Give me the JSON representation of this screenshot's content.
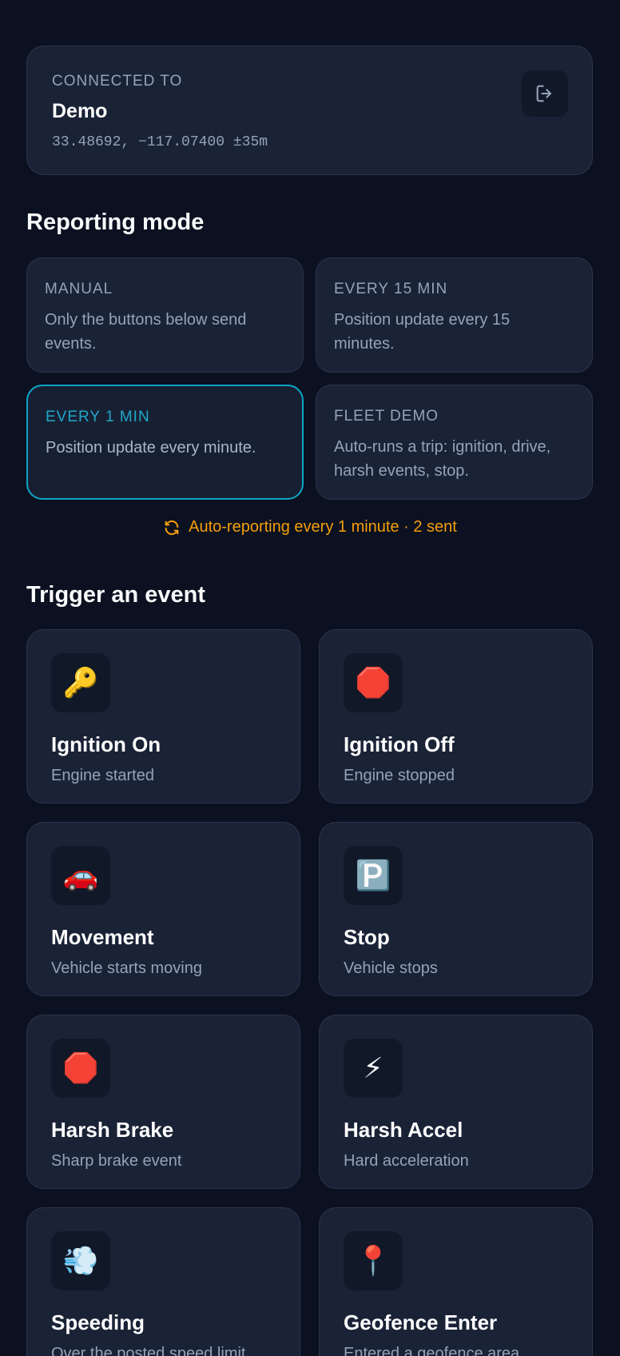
{
  "connection": {
    "label": "CONNECTED TO",
    "name": "Demo",
    "coords": "33.48692, −117.07400 ±35m",
    "logout_icon": "logout-icon"
  },
  "reporting": {
    "title": "Reporting mode",
    "modes": [
      {
        "title": "MANUAL",
        "desc": "Only the buttons below send events.",
        "active": false
      },
      {
        "title": "EVERY 15 MIN",
        "desc": "Position update every 15 minutes.",
        "active": false
      },
      {
        "title": "EVERY 1 MIN",
        "desc": "Position update every minute.",
        "active": true
      },
      {
        "title": "FLEET DEMO",
        "desc": "Auto-runs a trip: ignition, drive, harsh events, stop.",
        "active": false
      }
    ],
    "status": "Auto-reporting every 1 minute · 2 sent",
    "status_color": "#f59e0b",
    "active_color": "#0ea5c6"
  },
  "events": {
    "title": "Trigger an event",
    "items": [
      {
        "icon": "🔑",
        "icon_name": "key-icon",
        "title": "Ignition On",
        "sub": "Engine started"
      },
      {
        "icon": "🛑",
        "icon_name": "stop-sign-icon",
        "title": "Ignition Off",
        "sub": "Engine stopped"
      },
      {
        "icon": "🚗",
        "icon_name": "car-icon",
        "title": "Movement",
        "sub": "Vehicle starts moving"
      },
      {
        "icon": "🅿️",
        "icon_name": "parking-icon",
        "title": "Stop",
        "sub": "Vehicle stops"
      },
      {
        "icon": "🛑",
        "icon_name": "stop-sign-icon",
        "title": "Harsh Brake",
        "sub": "Sharp brake event"
      },
      {
        "icon": "⚡",
        "icon_name": "lightning-icon",
        "title": "Harsh Accel",
        "sub": "Hard acceleration"
      },
      {
        "icon": "💨",
        "icon_name": "dash-icon",
        "title": "Speeding",
        "sub": "Over the posted speed limit"
      },
      {
        "icon": "📍",
        "icon_name": "pin-icon",
        "title": "Geofence Enter",
        "sub": "Entered a geofence area"
      }
    ]
  }
}
